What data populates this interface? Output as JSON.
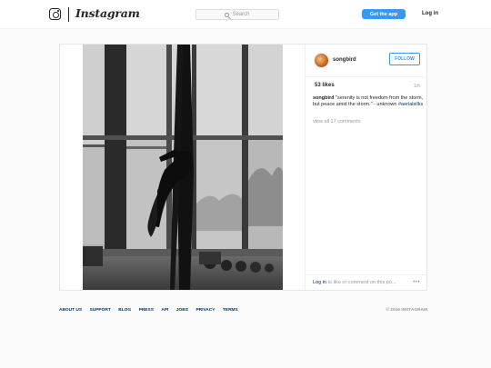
{
  "header": {
    "logo_icon": "instagram-camera-icon",
    "wordmark": "Instagram",
    "search_placeholder": "Search",
    "search_icon": "search-icon",
    "get_app_label": "Get the app",
    "login_label": "Log in",
    "accent_color": "#3897f0"
  },
  "post": {
    "image_description_icon": "aerial-silks-photo",
    "username": "songbird",
    "follow_label": "FOLLOW",
    "likes": "53 likes",
    "time_ago": "1m",
    "caption_user": "songbird",
    "caption_text": " \"serenity is not freedom from the storm, but peace amid the storm.\" - unknown ",
    "caption_hashtag": "#aerialsilks",
    "view_all": "view all 17 comments",
    "comment_login": "Log in",
    "comment_rest": " to like or comment on this po...",
    "more_icon": "more-options-icon"
  },
  "footer": {
    "links": [
      "ABOUT US",
      "SUPPORT",
      "BLOG",
      "PRESS",
      "API",
      "JOBS",
      "PRIVACY",
      "TERMS"
    ],
    "copyright": "© 2016 INSTAGRAM"
  }
}
